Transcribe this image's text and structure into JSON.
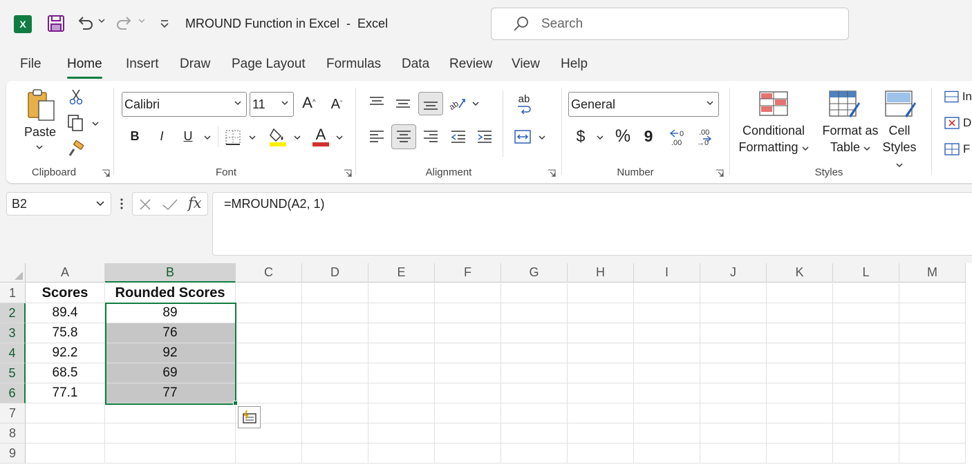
{
  "window": {
    "app_logo": "X",
    "title": "MROUND Function in Excel  -  Excel"
  },
  "search": {
    "placeholder": "Search"
  },
  "tabs": [
    "File",
    "Home",
    "Insert",
    "Draw",
    "Page Layout",
    "Formulas",
    "Data",
    "Review",
    "View",
    "Help"
  ],
  "active_tab": "Home",
  "ribbon": {
    "clipboard": {
      "label": "Clipboard",
      "paste_label": "Paste"
    },
    "font": {
      "label": "Font",
      "font_name": "Calibri",
      "font_size": "11",
      "bold_label": "B",
      "italic_label": "I",
      "underline_label": "U",
      "grow_label": "A",
      "shrink_label": "A",
      "font_color_label": "A"
    },
    "alignment": {
      "label": "Alignment",
      "wrap_label": "ab"
    },
    "number": {
      "label": "Number",
      "format": "General",
      "currency_label": "$",
      "percent_label": "%",
      "comma_label": "9"
    },
    "styles": {
      "label": "Styles",
      "conditional_line1": "Conditional",
      "conditional_line2": "Formatting",
      "format_table_line1": "Format as",
      "format_table_line2": "Table",
      "cell_styles_line1": "Cell",
      "cell_styles_line2": "Styles"
    },
    "cells": {
      "insert_label": "In",
      "delete_label": "D",
      "format_label": "F"
    }
  },
  "formula_bar": {
    "name_box": "B2",
    "fx_label": "fx",
    "formula": "=MROUND(A2, 1)"
  },
  "sheet": {
    "columns": [
      "A",
      "B",
      "C",
      "D",
      "E",
      "F",
      "G",
      "H",
      "I",
      "J",
      "K",
      "L",
      "M"
    ],
    "rows": [
      "1",
      "2",
      "3",
      "4",
      "5",
      "6",
      "7",
      "8",
      "9"
    ],
    "selected_column": "B",
    "header_row": [
      "Scores",
      "Rounded Scores"
    ],
    "data": [
      [
        "89.4",
        "89"
      ],
      [
        "75.8",
        "76"
      ],
      [
        "92.2",
        "92"
      ],
      [
        "68.5",
        "69"
      ],
      [
        "77.1",
        "77"
      ]
    ]
  },
  "colors": {
    "accent": "#107c41",
    "selection_fill": "#c6c6c6"
  }
}
